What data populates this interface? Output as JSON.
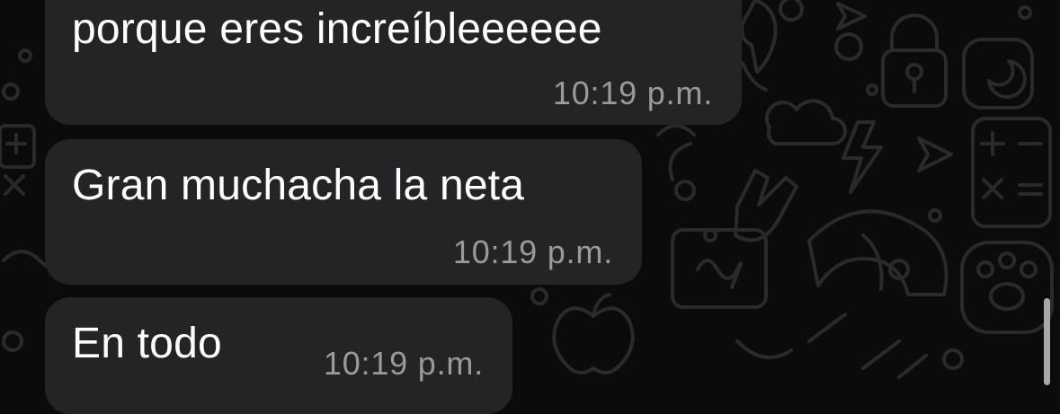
{
  "theme": {
    "background": "#0b0b0b",
    "bubble_color": "#232425",
    "text_color": "#ffffff",
    "timestamp_color": "#9a9a9c",
    "wallpaper_doodle_color": "#2a2a2a"
  },
  "messages": [
    {
      "text": "porque eres increíbleeeeee",
      "time": "10:19 p.m."
    },
    {
      "text": "Gran muchacha la neta",
      "time": "10:19 p.m."
    },
    {
      "text": "En todo",
      "time": "10:19 p.m."
    }
  ],
  "wallpaper": {
    "icons": [
      "lock-icon",
      "moon-icon",
      "apple-icon",
      "cloud-icon",
      "lightning-icon",
      "send-arrow-icon",
      "calculator-icon",
      "paw-icon",
      "helmet-icon",
      "rock-hand-icon",
      "note-icon",
      "bulb-icon"
    ]
  }
}
